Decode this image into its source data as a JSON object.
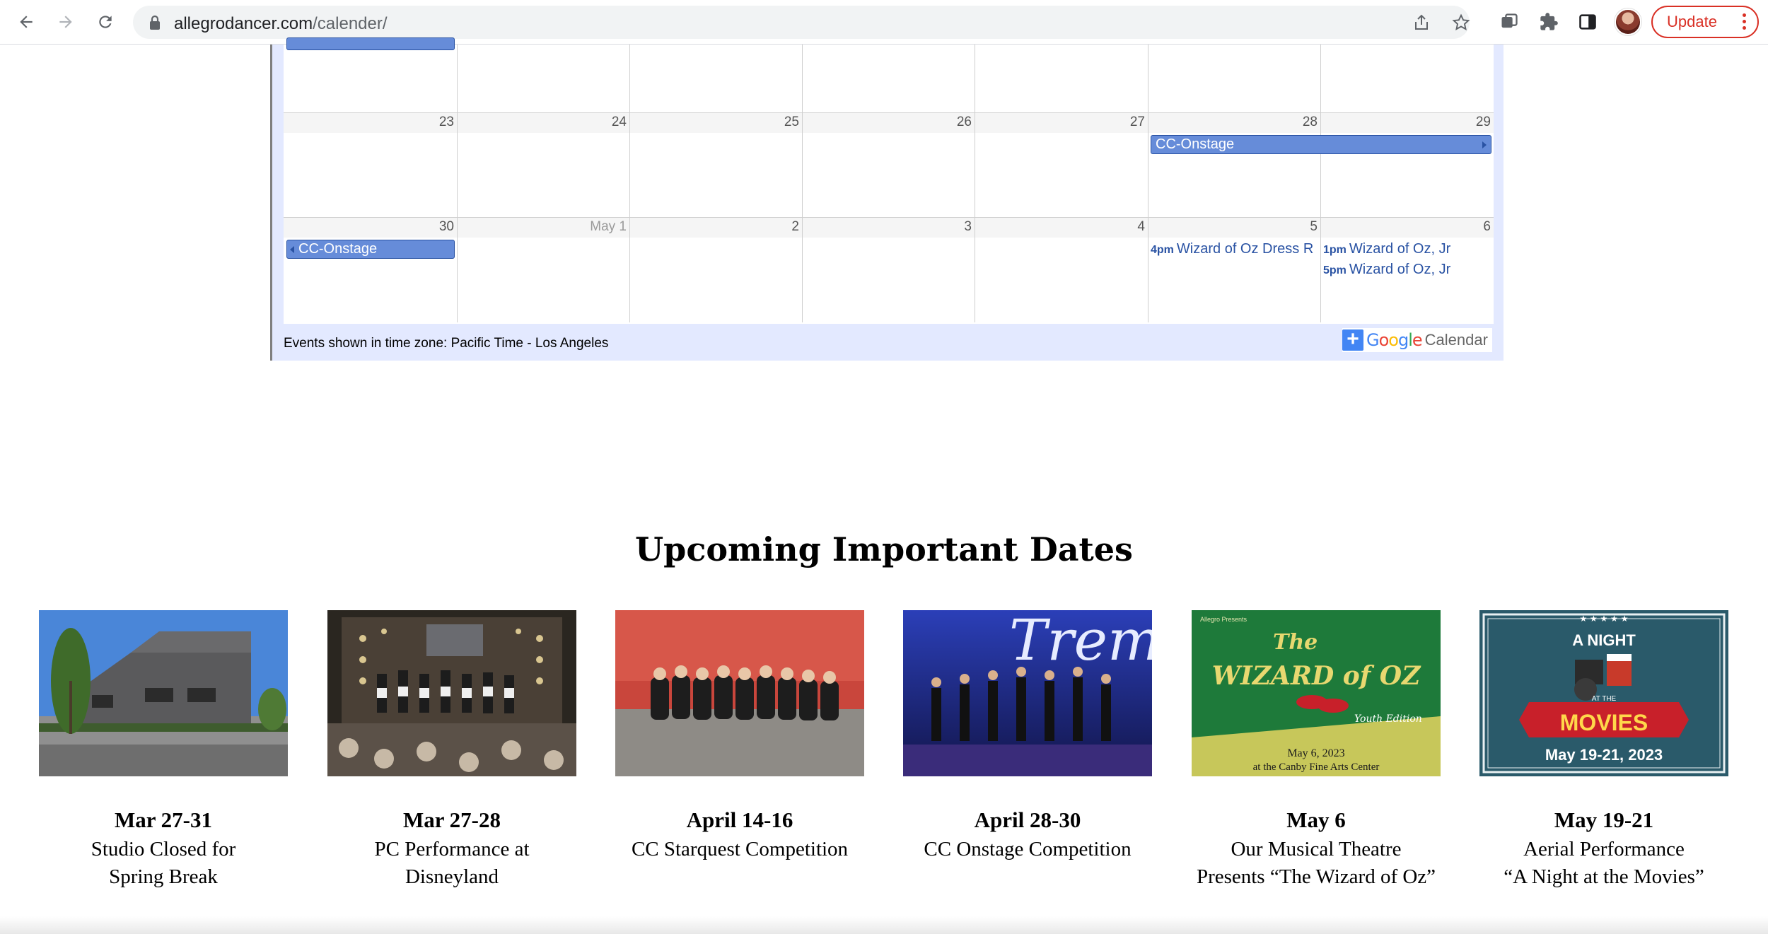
{
  "browser": {
    "url_host": "allegrodancer.com",
    "url_path": "/calender/",
    "update_label": "Update"
  },
  "calendar": {
    "week2": {
      "days": [
        "23",
        "24",
        "25",
        "26",
        "27",
        "28",
        "29"
      ],
      "bar": "CC-Onstage"
    },
    "week3": {
      "days": [
        "30",
        "May 1",
        "2",
        "3",
        "4",
        "5",
        "6"
      ],
      "bar": "CC-Onstage",
      "sat_events": [
        {
          "time": "4pm",
          "title": "Wizard of Oz Dress R"
        }
      ],
      "sun_events": [
        {
          "time": "1pm",
          "title": "Wizard of Oz, Jr"
        },
        {
          "time": "5pm",
          "title": "Wizard of Oz, Jr"
        }
      ]
    },
    "timezone_text": "Events shown in time zone: Pacific Time - Los Angeles",
    "google_word": "Google",
    "calendar_word": "Calendar"
  },
  "upcoming": {
    "title": "Upcoming Important Dates",
    "cards": [
      {
        "date": "Mar 27-31",
        "line1": "Studio Closed for",
        "line2": "Spring Break",
        "image": "studio-building-photo"
      },
      {
        "date": "Mar 27-28",
        "line1": "PC Performance at",
        "line2": "Disneyland",
        "image": "disneyland-stage-photo"
      },
      {
        "date": "April 14-16",
        "line1": "CC Starquest Competition",
        "line2": "",
        "image": "team-group-photo"
      },
      {
        "date": "April 28-30",
        "line1": "CC Onstage Competition",
        "line2": "",
        "image": "dancers-on-stage-photo"
      },
      {
        "date": "May 6",
        "line1": "Our Musical Theatre",
        "line2": "Presents “The Wizard of Oz”",
        "image": "wizard-of-oz-poster"
      },
      {
        "date": "May 19-21",
        "line1": "Aerial Performance",
        "line2": "“A Night at the Movies”",
        "image": "night-at-movies-poster"
      }
    ],
    "poster_oz": {
      "presenter": "Allegro Presents",
      "the": "The",
      "title": "WIZARD of OZ",
      "edition": "Youth Edition",
      "date": "May 6, 2023",
      "venue": "at the Canby Fine Arts Center"
    },
    "poster_movies": {
      "top": "A NIGHT",
      "at": "AT THE",
      "title": "MOVIES",
      "dates": "May 19-21, 2023"
    },
    "poster_tremaine": {
      "text": "Trema"
    }
  }
}
